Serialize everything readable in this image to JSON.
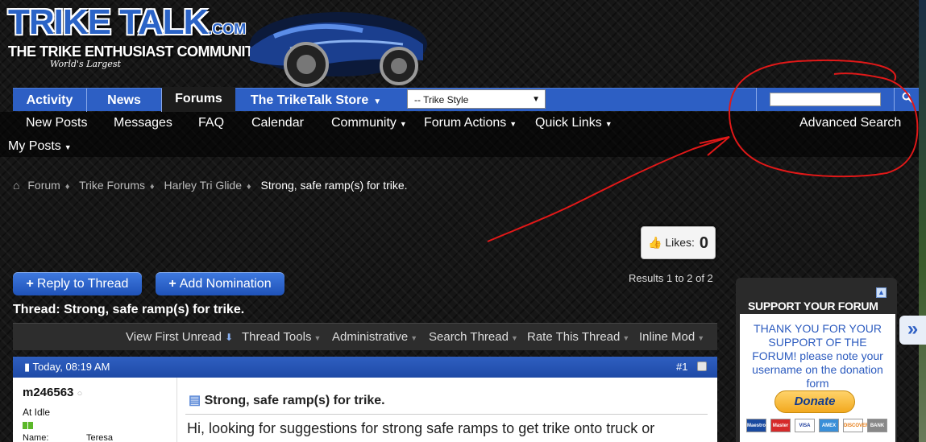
{
  "logo": {
    "main": "TRIKE TALK",
    "dotcom": ".COM",
    "subtitle": "THE TRIKE ENTHUSIAST COMMUNITY",
    "tagline": "World's Largest"
  },
  "tabs": [
    {
      "label": "Activity"
    },
    {
      "label": "News"
    },
    {
      "label": "Forums"
    },
    {
      "label": "The TrikeTalk Store"
    }
  ],
  "style_select": {
    "value": "-- Trike Style"
  },
  "subnav": {
    "items": [
      "New Posts",
      "Messages",
      "FAQ",
      "Calendar",
      "Community",
      "Forum Actions",
      "Quick Links"
    ],
    "advanced_search": "Advanced Search",
    "my_posts": "My Posts"
  },
  "breadcrumb": {
    "items": [
      "Forum",
      "Trike Forums",
      "Harley Tri Glide"
    ],
    "current": "Strong, safe ramp(s) for trike."
  },
  "likes": {
    "label": "Likes:",
    "count": "0"
  },
  "results": "Results 1 to 2 of 2",
  "buttons": {
    "reply": "Reply to Thread",
    "nomination": "Add Nomination"
  },
  "thread": {
    "title": "Thread: Strong, safe ramp(s) for trike."
  },
  "toolbar": {
    "view_first_unread": "View First Unread",
    "thread_tools": "Thread Tools",
    "administrative": "Administrative",
    "search_thread": "Search Thread",
    "rate_thread": "Rate This Thread",
    "inline_mod": "Inline Mod"
  },
  "post": {
    "date": "Today, 08:19 AM",
    "number": "#1",
    "username": "m246563",
    "status": "At Idle",
    "name_label": "Name:",
    "name_value": "Teresa",
    "title": "Strong, safe ramp(s) for trike.",
    "body": "Hi, looking for suggestions for strong safe ramps to get trike onto truck or"
  },
  "sidebar": {
    "title": "SUPPORT YOUR FORUM",
    "message": "THANK YOU FOR YOUR SUPPORT OF THE FORUM! please note your username on the donation form",
    "donate": "Donate",
    "cards": [
      "Maestro",
      "Master",
      "VISA",
      "AMEX",
      "DISCOVER",
      "BANK"
    ]
  },
  "colors": {
    "nav_blue": "#2d5fc4",
    "annotation_red": "#e01818"
  }
}
